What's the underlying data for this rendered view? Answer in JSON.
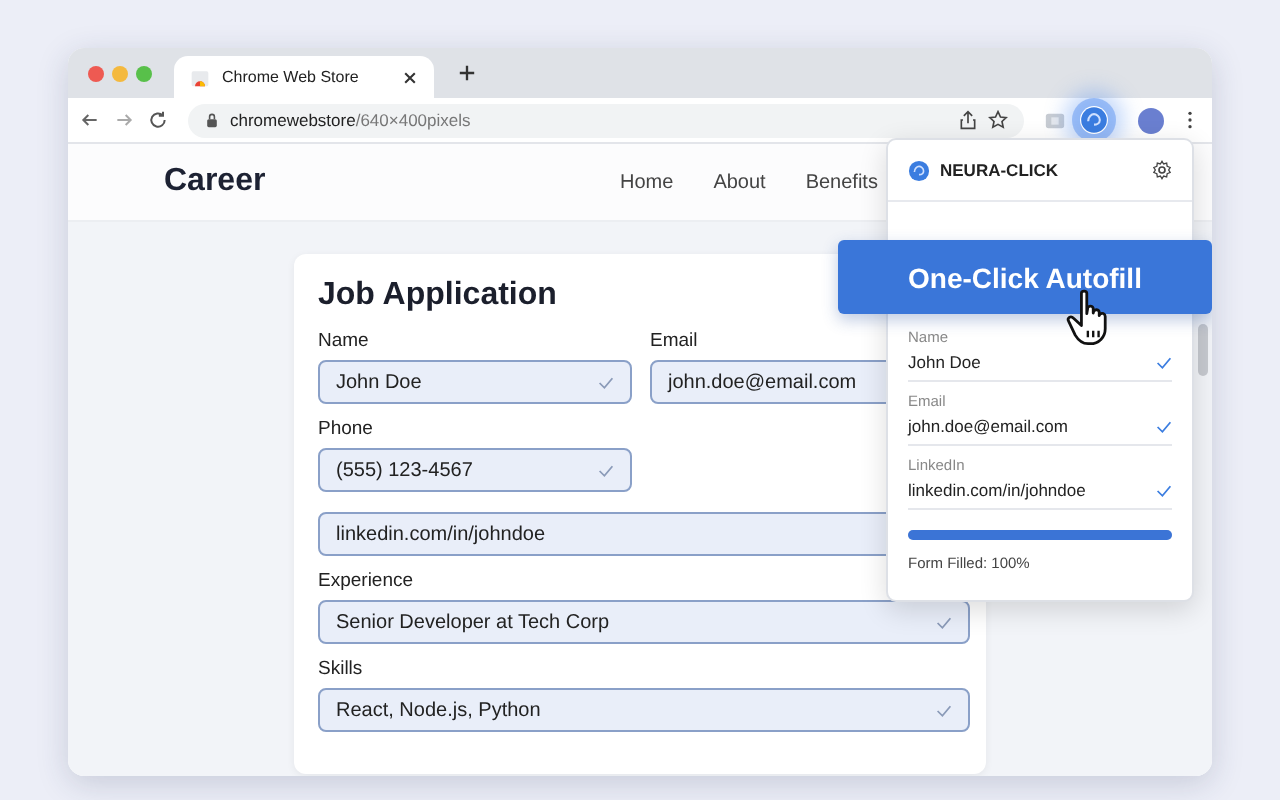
{
  "browser": {
    "tab_title": "Chrome Web Store",
    "url_host": "chromewebstore",
    "url_path": "/640×400pixels"
  },
  "site": {
    "logo": "Career",
    "nav": [
      "Home",
      "About",
      "Benefits"
    ]
  },
  "form": {
    "title": "Job Application",
    "fields": [
      {
        "kind": "short",
        "label": "Name",
        "value": "John Doe",
        "checked": true
      },
      {
        "kind": "short",
        "label": "Email",
        "value": "john.doe@email.com"
      },
      {
        "kind": "short",
        "label": "Phone",
        "value": "(555) 123-4567",
        "checked": true
      },
      {
        "kind": "long",
        "value": "linkedin.com/in/johndoe"
      },
      {
        "kind": "long",
        "label": "Experience",
        "value": "Senior Developer at Tech Corp",
        "checked": true
      },
      {
        "kind": "long",
        "label": "Skills",
        "value": "React, Node.js, Python",
        "checked": true
      }
    ]
  },
  "extension": {
    "name": "NEURA-CLICK",
    "button": "One-Click Autofill",
    "fields": [
      {
        "label": "Name",
        "value": "John Doe",
        "checked": true
      },
      {
        "label": "Email",
        "value": "john.doe@email.com",
        "checked": true
      },
      {
        "label": "LinkedIn",
        "value": "linkedin.com/in/johndoe",
        "checked": true
      }
    ],
    "progress": {
      "level": 1.0,
      "label": "Form Filled: 100%"
    }
  }
}
